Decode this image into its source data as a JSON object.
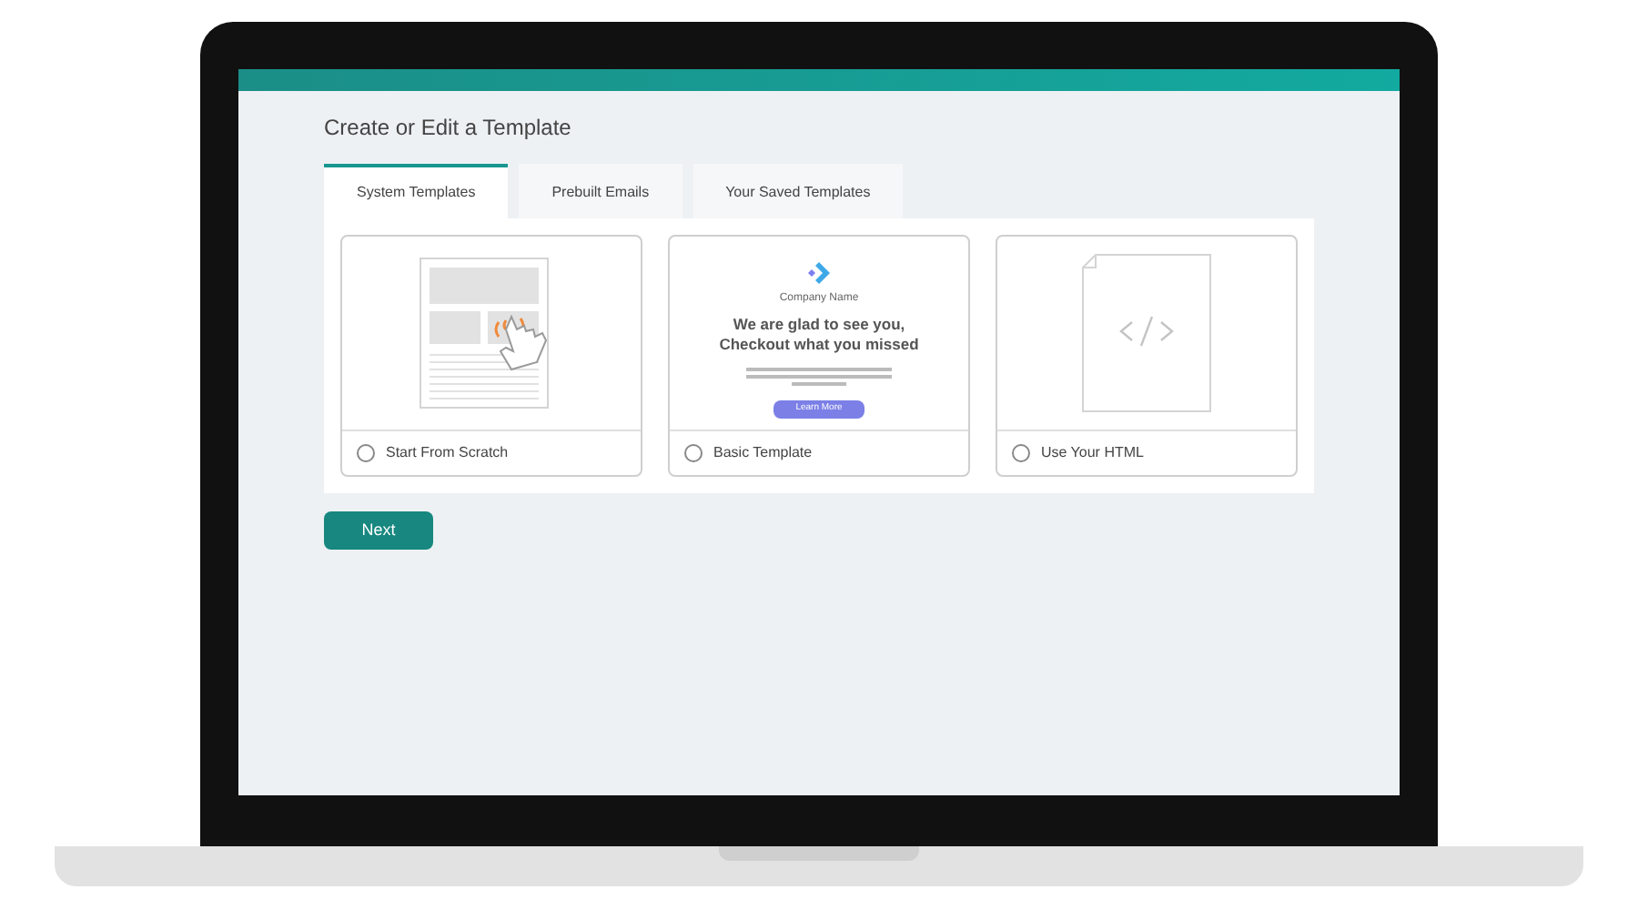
{
  "page": {
    "title": "Create or Edit a Template"
  },
  "tabs": [
    {
      "label": "System Templates",
      "selected": true
    },
    {
      "label": "Prebuilt Emails",
      "selected": false
    },
    {
      "label": "Your Saved Templates",
      "selected": false
    }
  ],
  "templates": [
    {
      "kind": "scratch",
      "label": "Start From Scratch",
      "selected": false
    },
    {
      "kind": "basic",
      "label": "Basic Template",
      "selected": false,
      "company": "Company Name",
      "headline": "We are glad to see you, Checkout what you missed",
      "button": "Learn More"
    },
    {
      "kind": "html",
      "label": "Use Your HTML",
      "selected": false
    }
  ],
  "next_button": "Next"
}
